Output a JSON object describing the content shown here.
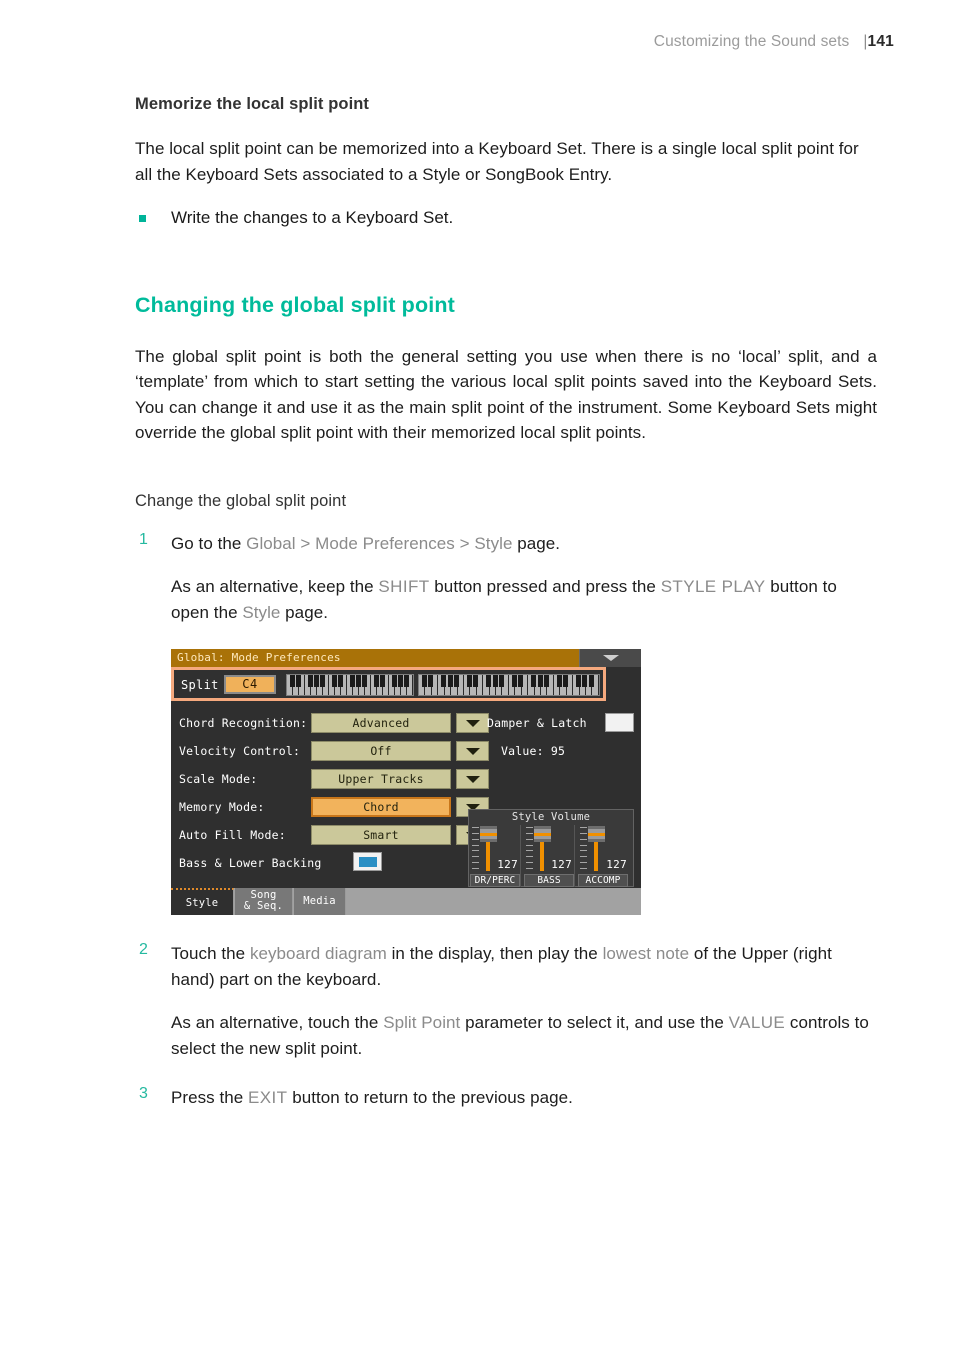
{
  "header": {
    "running_title": "Customizing the Sound sets",
    "separator": "|",
    "page_number": "141"
  },
  "sections": {
    "memorize": {
      "heading": "Memorize the local split point",
      "paragraph": "The local split point can be memorized into a Keyboard Set. There is a single local split point for all the Keyboard Sets associated to a Style or SongBook Entry.",
      "bullet": "Write the changes to a Keyboard Set."
    },
    "changing": {
      "heading": "Changing the global split point",
      "paragraph": "The global split point is both the general setting you use when there is no ‘local’ split, and a ‘template’ from which to start setting the various local split points saved into the Keyboard Sets. You can change it and use it as the main split point of the instrument. Some Keyboard Sets might override the global split point with their memorized local split points.",
      "procedure_heading": "Change the global split point"
    }
  },
  "steps": {
    "one": {
      "number": "1",
      "text_a": "Go to the ",
      "ui_global": "Global",
      "sep1": " > ",
      "ui_modeprefs": "Mode Preferences",
      "sep2": " > ",
      "ui_style": "Style",
      "text_b": " page.",
      "alt_a": "As an alternative, keep the ",
      "alt_shift": "SHIFT",
      "alt_b": " button pressed and press the ",
      "alt_styleplay": "STYLE PLAY",
      "alt_c": " button to open the ",
      "alt_style": "Style",
      "alt_d": " page."
    },
    "two": {
      "number": "2",
      "text_a": "Touch the ",
      "ui_kbddiagram": "keyboard diagram",
      "text_b": " in the display, then play the ",
      "ui_lowestnote": "lowest note",
      "text_c": " of the Upper (right hand) part on the keyboard.",
      "alt_a": "As an alternative, touch the ",
      "alt_splitpoint": "Split Point",
      "alt_b": " parameter to select it, and use the ",
      "alt_value": "VALUE",
      "alt_c": " controls to select the new split point."
    },
    "three": {
      "number": "3",
      "text_a": "Press the ",
      "ui_exit": "EXIT",
      "text_b": " button to return to the previous page."
    }
  },
  "device": {
    "title": "Global: Mode Preferences",
    "menu_icon": "chevron-down-icon",
    "split": {
      "label": "Split",
      "value": "C4"
    },
    "params": [
      {
        "label": "Chord Recognition:",
        "value": "Advanced",
        "highlighted": false
      },
      {
        "label": "Velocity Control:",
        "value": "Off",
        "highlighted": false
      },
      {
        "label": "Scale Mode:",
        "value": "Upper Tracks",
        "highlighted": false
      },
      {
        "label": "Memory Mode:",
        "value": "Chord",
        "highlighted": true
      },
      {
        "label": "Auto Fill Mode:",
        "value": "Smart",
        "highlighted": false
      }
    ],
    "damper": {
      "label": "Damper & Latch",
      "checked": false
    },
    "damper_value": "Value: 95",
    "bass_lower": {
      "label": "Bass & Lower Backing",
      "checked": true
    },
    "style_volume": {
      "title": "Style Volume",
      "faders": [
        {
          "name": "DR/PERC",
          "value": "127"
        },
        {
          "name": "BASS",
          "value": "127"
        },
        {
          "name": "ACCOMP",
          "value": "127"
        }
      ]
    },
    "tabs": [
      {
        "label": "Style",
        "label2": "",
        "active": true
      },
      {
        "label": "Song",
        "label2": "& Seq.",
        "active": false
      },
      {
        "label": "Media",
        "label2": "",
        "active": false
      }
    ]
  },
  "colors": {
    "accent_teal": "#00bb9b",
    "ui_gray": "#8b8b8b",
    "device_highlight": "#f5a97e",
    "device_title_bar": "#a97208"
  }
}
